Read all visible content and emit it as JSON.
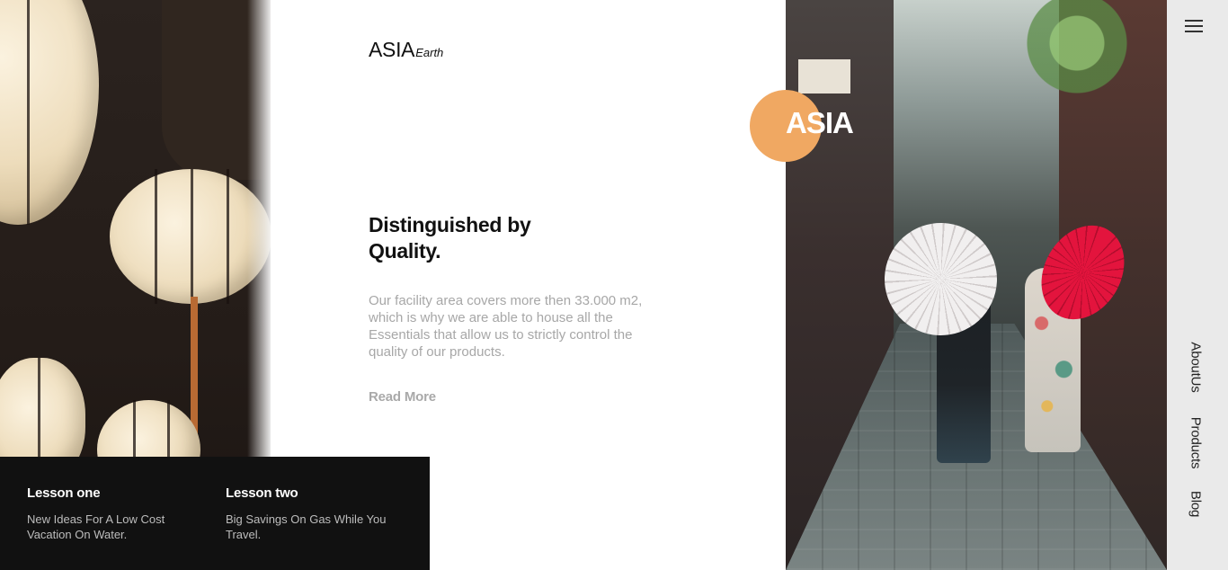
{
  "brand": {
    "name": "ASIA",
    "suffix": "Earth"
  },
  "badge": {
    "text": "ASIA",
    "color": "#f0a862"
  },
  "hero": {
    "headline_line1": "Distinguished by",
    "headline_line2": "Quality.",
    "description": "Our facility area covers more then 33.000 m2, which is why we are able to house all the Essentials that allow us to strictly control the quality of our products.",
    "read_more": "Read More"
  },
  "lessons": [
    {
      "title": "Lesson one",
      "text": "New Ideas For A Low Cost Vacation On Water."
    },
    {
      "title": "Lesson two",
      "text": "Big Savings On Gas While You Travel."
    }
  ],
  "sidebar": {
    "menu_icon": "hamburger-menu-icon",
    "items": [
      {
        "label": "AboutUs"
      },
      {
        "label": "Products"
      },
      {
        "label": "Blog"
      }
    ]
  },
  "colors": {
    "accent": "#f0a862",
    "lesson_bg": "#111111",
    "sidebar_bg": "#eaeaea"
  }
}
